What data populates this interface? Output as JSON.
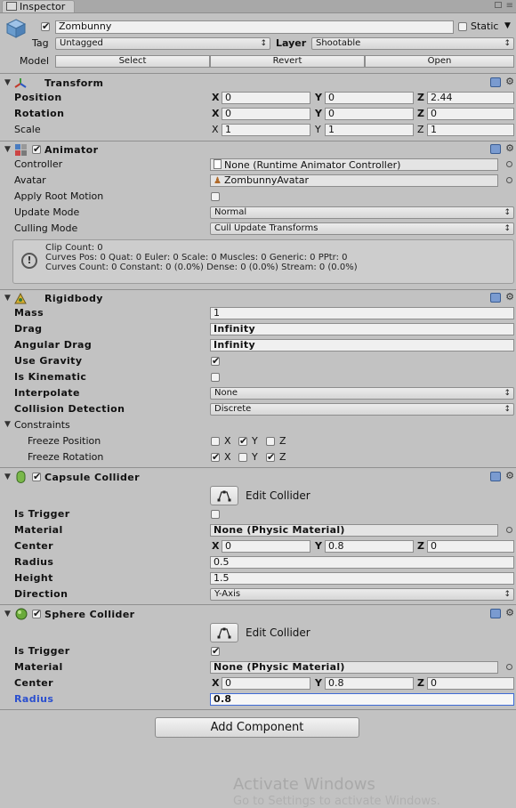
{
  "tab": {
    "title": "Inspector"
  },
  "object": {
    "name": "Zombunny",
    "active": true,
    "static_label": "Static",
    "tag_label": "Tag",
    "tag_value": "Untagged",
    "layer_label": "Layer",
    "layer_value": "Shootable",
    "model_label": "Model",
    "model_buttons": [
      "Select",
      "Revert",
      "Open"
    ]
  },
  "transform": {
    "title": "Transform",
    "rows": [
      {
        "label": "Position",
        "x": "0",
        "y": "0",
        "z": "2.44"
      },
      {
        "label": "Rotation",
        "x": "0",
        "y": "0",
        "z": "0"
      },
      {
        "label": "Scale",
        "x": "1",
        "y": "1",
        "z": "1"
      }
    ]
  },
  "axes": {
    "x": "X",
    "y": "Y",
    "z": "Z"
  },
  "animator": {
    "title": "Animator",
    "enabled": true,
    "controller_label": "Controller",
    "controller_value": "None (Runtime Animator Controller)",
    "avatar_label": "Avatar",
    "avatar_value": "ZombunnyAvatar",
    "root_motion_label": "Apply Root Motion",
    "root_motion": false,
    "update_mode_label": "Update Mode",
    "update_mode_value": "Normal",
    "culling_mode_label": "Culling Mode",
    "culling_mode_value": "Cull Update Transforms",
    "info_lines": [
      "Clip Count: 0",
      "Curves Pos: 0 Quat: 0 Euler: 0 Scale: 0 Muscles: 0 Generic: 0 PPtr: 0",
      "Curves Count: 0 Constant: 0 (0.0%) Dense: 0 (0.0%) Stream: 0 (0.0%)"
    ]
  },
  "rigidbody": {
    "title": "Rigidbody",
    "mass_label": "Mass",
    "mass": "1",
    "drag_label": "Drag",
    "drag": "Infinity",
    "angular_drag_label": "Angular Drag",
    "angular_drag": "Infinity",
    "use_gravity_label": "Use Gravity",
    "use_gravity": true,
    "is_kinematic_label": "Is Kinematic",
    "is_kinematic": false,
    "interpolate_label": "Interpolate",
    "interpolate": "None",
    "collision_label": "Collision Detection",
    "collision": "Discrete",
    "constraints_label": "Constraints",
    "freeze_position_label": "Freeze Position",
    "freeze_position": {
      "x": false,
      "y": true,
      "z": false
    },
    "freeze_rotation_label": "Freeze Rotation",
    "freeze_rotation": {
      "x": true,
      "y": false,
      "z": true
    }
  },
  "capsule": {
    "title": "Capsule Collider",
    "enabled": true,
    "edit_label": "Edit Collider",
    "is_trigger_label": "Is Trigger",
    "is_trigger": false,
    "material_label": "Material",
    "material": "None (Physic Material)",
    "center_label": "Center",
    "center": {
      "x": "0",
      "y": "0.8",
      "z": "0"
    },
    "radius_label": "Radius",
    "radius": "0.5",
    "height_label": "Height",
    "height": "1.5",
    "direction_label": "Direction",
    "direction": "Y-Axis"
  },
  "sphere": {
    "title": "Sphere Collider",
    "enabled": true,
    "edit_label": "Edit Collider",
    "is_trigger_label": "Is Trigger",
    "is_trigger": true,
    "material_label": "Material",
    "material": "None (Physic Material)",
    "center_label": "Center",
    "center": {
      "x": "0",
      "y": "0.8",
      "z": "0"
    },
    "radius_label": "Radius",
    "radius": "0.8"
  },
  "add_component_label": "Add Component",
  "watermark": {
    "line1": "Activate Windows",
    "line2": "Go to Settings to activate Windows."
  },
  "colors": {
    "focus_label": "#2a4fcf",
    "panel_bg": "#c2c2c2"
  }
}
